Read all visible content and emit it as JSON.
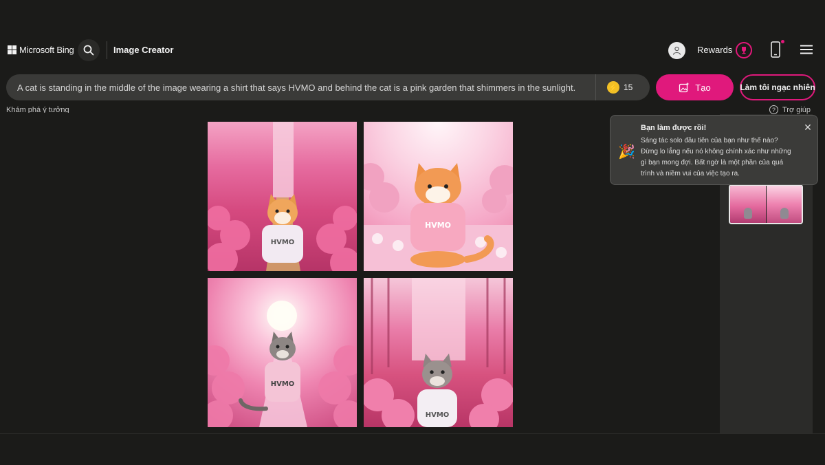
{
  "header": {
    "brand": "Microsoft Bing",
    "app_title": "Image Creator",
    "rewards_label": "Rewards"
  },
  "prompt": {
    "text": "A cat is standing in the middle of the image wearing a shirt that says HVMO and behind the cat is a pink garden that shimmers in the sunlight.",
    "boosts": "15"
  },
  "actions": {
    "create_label": "Tạo",
    "surprise_label": "Làm tôi ngạc nhiên"
  },
  "subbar": {
    "explore_label": "Khám phá ý tưởng",
    "help_label": "Trợ giúp"
  },
  "images": [
    {
      "shirt_text": "HVMO",
      "cat": "orange-white"
    },
    {
      "shirt_text": "HVMO",
      "cat": "orange-white"
    },
    {
      "shirt_text": "HVMO",
      "cat": "grey-tabby"
    },
    {
      "shirt_text": "HVMO",
      "cat": "grey-tabby"
    }
  ],
  "popup": {
    "title": "Bạn làm được rồi!",
    "body": "Sáng tác solo đầu tiên của bạn như thế nào? Đừng lo lắng nếu nó không chính xác như những gì bạn mong đợi. Bất ngờ là một phần của quá trình và niềm vui của việc tạo ra."
  },
  "colors": {
    "accent": "#e0197c",
    "background": "#1b1b19",
    "prompt_bg": "#3a3a38",
    "boost_coin": "#f2c026"
  },
  "icons": [
    "windows-logo-icon",
    "search-icon",
    "user-icon",
    "trophy-icon",
    "phone-icon",
    "hamburger-menu-icon",
    "coin-icon",
    "image-sparkle-icon",
    "help-icon",
    "confetti-icon",
    "close-icon"
  ]
}
